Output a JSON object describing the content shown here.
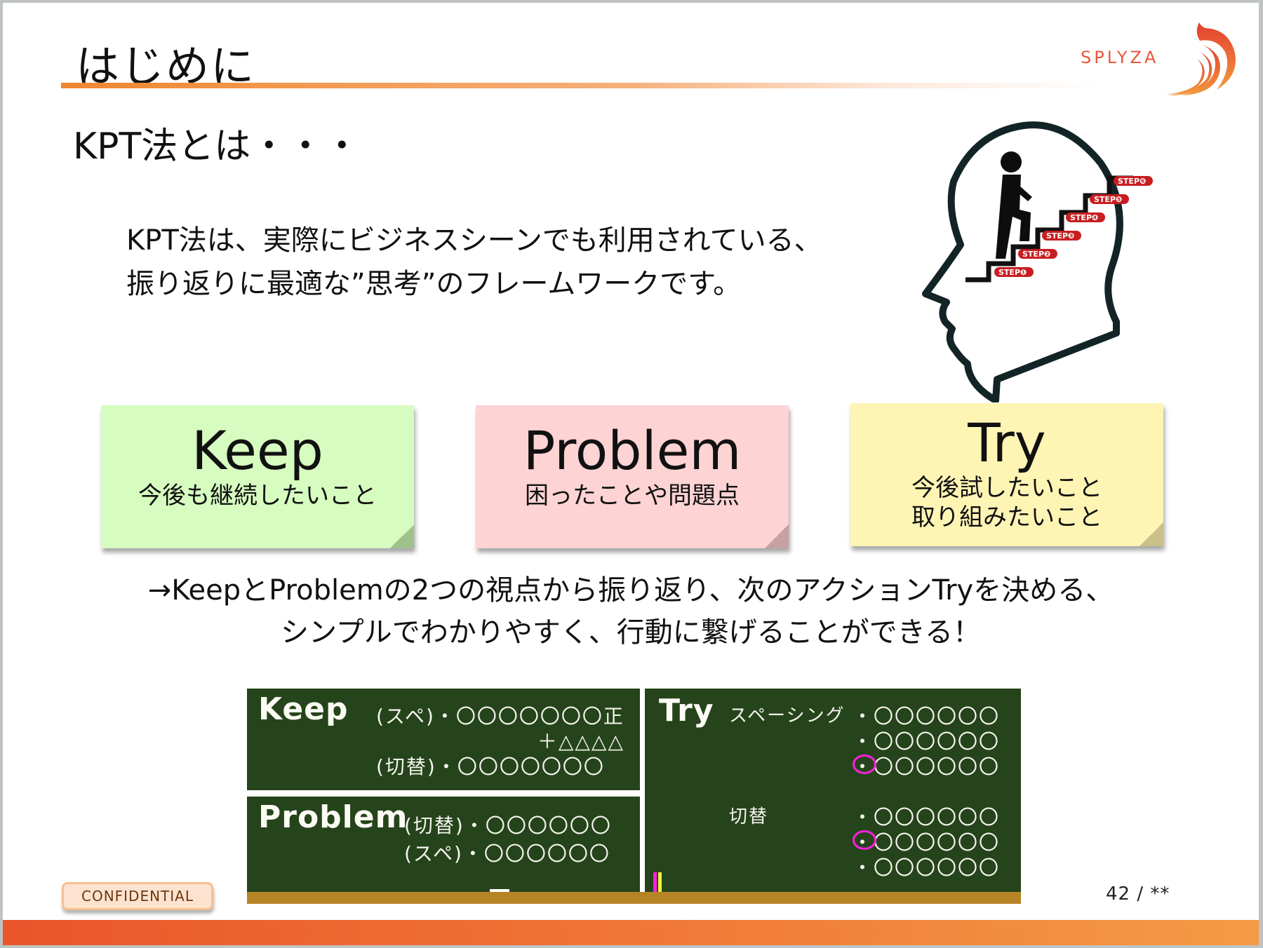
{
  "slide": {
    "title": "はじめに",
    "logo_text": "SPLYZA",
    "subtitle": "KPT法とは・・・",
    "intro_lines": [
      "KPT法は、実際にビジネスシーンでも利用されている、",
      "振り返りに最適な”思考”のフレームワークです。"
    ],
    "illustration": {
      "steps": [
        "STEP❶",
        "STEP❷",
        "STEP❸",
        "STEP❹",
        "STEP❺",
        "STEP❻"
      ]
    },
    "notes": [
      {
        "title": "Keep",
        "lines": [
          "今後も継続したいこと"
        ],
        "color": "#d6fcc0"
      },
      {
        "title": "Problem",
        "lines": [
          "困ったことや問題点"
        ],
        "color": "#fdd3d4"
      },
      {
        "title": "Try",
        "lines": [
          "今後試したいこと",
          "取り組みたいこと"
        ],
        "color": "#fef5b5"
      }
    ],
    "summary_lines": [
      "→KeepとProblemの2つの視点から振り返り、次のアクションTryを決める、",
      "シンプルでわかりやすく、行動に繋げることができる！"
    ],
    "blackboard": {
      "keep": {
        "label": "Keep",
        "lines": [
          "(スペ)・〇〇〇〇〇〇〇正",
          "＋△△△△",
          "(切替)・〇〇〇〇〇〇〇"
        ]
      },
      "problem": {
        "label": "Problem",
        "lines": [
          "(切替)・〇〇〇〇〇〇",
          "(スペ)・〇〇〇〇〇〇"
        ]
      },
      "try": {
        "label": "Try",
        "group1_label": "スペーシング",
        "group1_lines": [
          "・〇〇〇〇〇〇",
          "・〇〇〇〇〇〇",
          "・〇〇〇〇〇〇"
        ],
        "group2_label": "切替",
        "group2_lines": [
          "・〇〇〇〇〇〇",
          "・〇〇〇〇〇〇",
          "・〇〇〇〇〇〇"
        ]
      },
      "colors": {
        "board": "#26441b",
        "rail": "#b58425",
        "marker": "#ff1fe0"
      }
    },
    "confidential_label": "CONFIDENTIAL",
    "page_number": "42 / **",
    "colors": {
      "accent": "#f0872f",
      "footer": "#ea552c",
      "logo": "#e8573a"
    }
  }
}
